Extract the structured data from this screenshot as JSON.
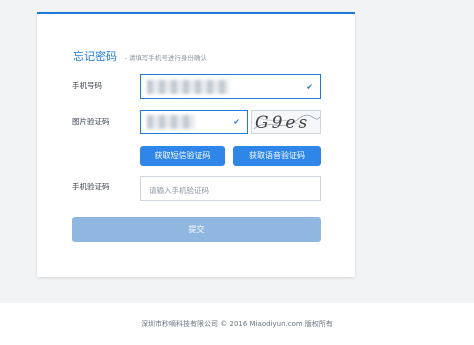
{
  "form": {
    "title": "忘记密码",
    "subtitle": "- 请填写手机号进行身份确认",
    "phone_label": "手机号码",
    "image_code_label": "图片验证码",
    "captcha_text": "G9es",
    "sms_button": "获取短信验证码",
    "voice_button": "获取语音验证码",
    "sms_code_label": "手机验证码",
    "sms_code_placeholder": "请输入手机验证码",
    "submit_button": "提交"
  },
  "footer": {
    "text": "深圳市秒嘀科技有限公司 © 2016 Miaodiyun.com 版权所有"
  },
  "colors": {
    "accent": "#1f7bd8",
    "button": "#2f86e8",
    "submit_disabled": "#8fb7e0"
  }
}
